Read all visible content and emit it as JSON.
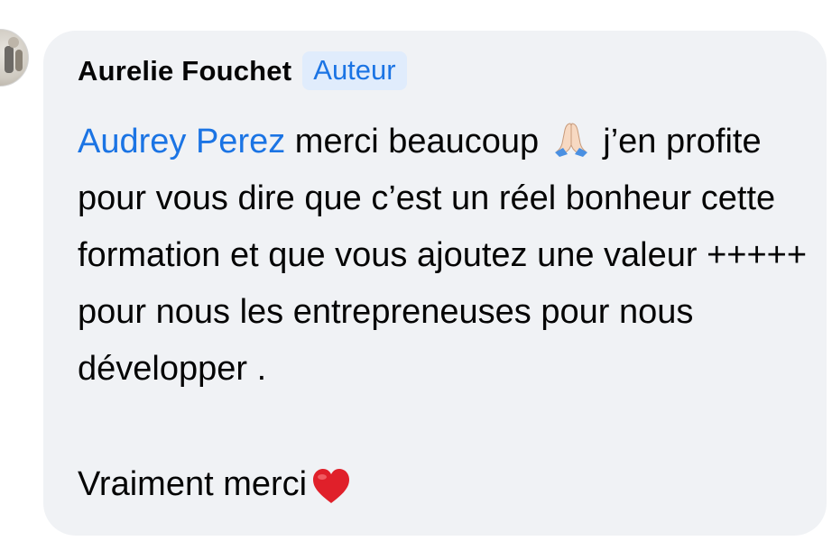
{
  "comment": {
    "author": "Aurelie Fouchet",
    "badge": "Auteur",
    "mention": "Audrey Perez",
    "text_after_mention": " merci beaucoup ",
    "text_after_emoji": " j’en profite pour vous dire que c’est un réel bonheur cette formation et que vous ajoutez une valeur +++++ pour nous les entrepreneuses pour nous développer .",
    "closing_text": "Vraiment merci ",
    "emojis": {
      "first": "folded-hands-icon",
      "second": "red-heart-icon"
    }
  },
  "colors": {
    "bubble_bg": "#f0f2f5",
    "mention": "#1b74e4",
    "badge_bg": "#e0ecfc",
    "text": "#050505",
    "heart": "#e0202a"
  }
}
